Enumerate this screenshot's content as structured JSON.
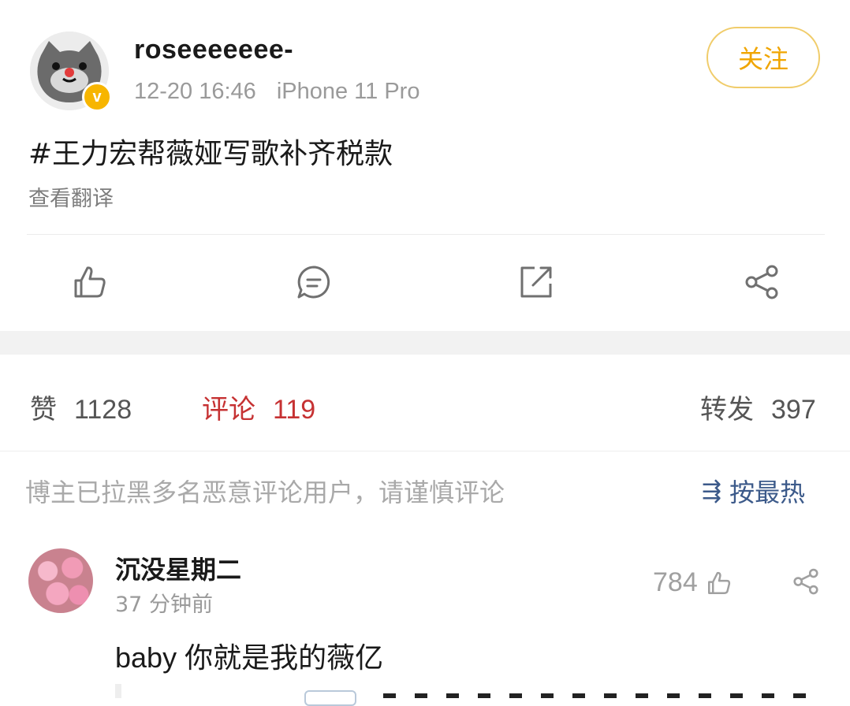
{
  "post": {
    "username": "roseeeeeee-",
    "timestamp": "12-20 16:46",
    "device": "iPhone 11 Pro",
    "follow_label": "关注",
    "verified_badge": "v",
    "text": "#王力宏帮薇娅写歌补齐税款",
    "translate_label": "查看翻译",
    "actions": [
      "thumbs-up-icon",
      "comment-icon",
      "repost-icon",
      "share-icon"
    ]
  },
  "stats": {
    "likes_label": "赞",
    "likes_count": "1128",
    "comments_label": "评论",
    "comments_count": "119",
    "reposts_label": "转发",
    "reposts_count": "397"
  },
  "comments_header": {
    "notice": "博主已拉黑多名恶意评论用户，请谨慎评论",
    "sort_icon": "⇶",
    "sort_label": "按最热"
  },
  "comments": [
    {
      "name": "沉没星期二",
      "time": "37 分钟前",
      "likes": "784",
      "text_latin": "baby ",
      "text_cn": "你就是我的薇亿"
    }
  ],
  "colors": {
    "accent_gold": "#f0a500",
    "active_red": "#c63233",
    "link_blue": "#3c5a8a",
    "muted_gray": "#9a9a9a"
  }
}
